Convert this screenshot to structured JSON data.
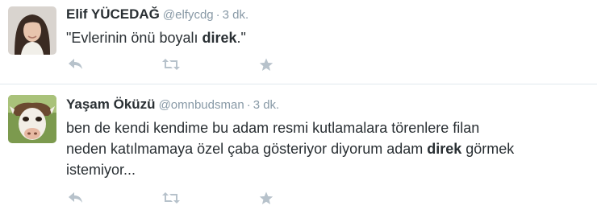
{
  "tweets": [
    {
      "fullname": "Elif YÜCEDAĞ",
      "username": "@elfycdg",
      "separator": "·",
      "time": "3 dk.",
      "text_before": "\"Evlerinin önü boyalı ",
      "text_bold": "direk",
      "text_after": ".\"",
      "actions": [
        "reply-icon",
        "retweet-icon",
        "favorite-icon"
      ]
    },
    {
      "fullname": "Yaşam Öküzü",
      "username": "@omnbudsman",
      "separator": "·",
      "time": "3 dk.",
      "text_line1": "ben de kendi kendime bu adam resmi kutlamalara törenlere filan",
      "text_line2_before": "neden katılmamaya özel çaba gösteriyor diyorum adam ",
      "text_bold": "direk",
      "text_line2_after": " görmek",
      "text_line3": "istemiyor...",
      "actions": [
        "reply-icon",
        "retweet-icon",
        "favorite-icon"
      ]
    }
  ],
  "colors": {
    "text": "#292f33",
    "muted": "#8899a6",
    "icon": "#b7c2cb",
    "divider": "#e1e8ed"
  }
}
